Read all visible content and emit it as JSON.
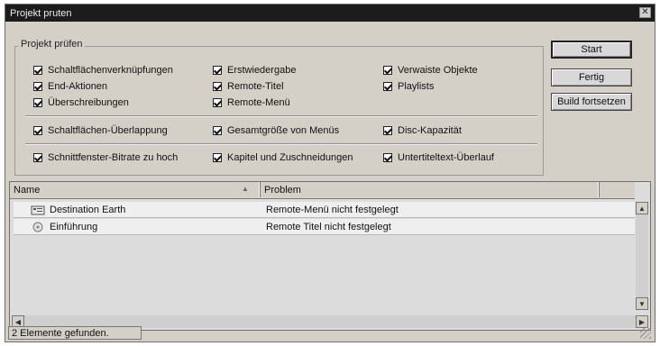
{
  "window": {
    "title": "Projekt pruten"
  },
  "group": {
    "title": "Projekt prüfen",
    "checkboxes": [
      {
        "label": "Schaltflächenverknüpfungen",
        "checked": true
      },
      {
        "label": "End-Aktionen",
        "checked": true
      },
      {
        "label": "Überschreibungen",
        "checked": true
      },
      {
        "label": "Erstwiedergabe",
        "checked": true
      },
      {
        "label": "Remote-Titel",
        "checked": true
      },
      {
        "label": "Remote-Menü",
        "checked": true
      },
      {
        "label": "Verwaiste Objekte",
        "checked": true
      },
      {
        "label": "Playlists",
        "checked": true
      },
      {
        "label": "Schaltflächen-Überlappung",
        "checked": true
      },
      {
        "label": "Gesamtgröße von Menüs",
        "checked": true
      },
      {
        "label": "Disc-Kapazität",
        "checked": true
      },
      {
        "label": "Schnittfenster-Bitrate zu hoch",
        "checked": true
      },
      {
        "label": "Kapitel und Zuschneidungen",
        "checked": true
      },
      {
        "label": "Untertiteltext-Überlauf",
        "checked": true
      }
    ]
  },
  "buttons": {
    "start": "Start",
    "fertig": "Fertig",
    "build": "Build fortsetzen"
  },
  "list": {
    "columns": [
      "Name",
      "Problem"
    ],
    "rows": [
      {
        "name": "Destination Earth",
        "problem": "Remote-Menü nicht festgelegt",
        "icon": "menu-icon"
      },
      {
        "name": "Einführung",
        "problem": "Remote Titel nicht festgelegt",
        "icon": "disc-icon"
      }
    ]
  },
  "status": {
    "text": "2 Elemente gefunden."
  },
  "icons": {
    "close": "close-icon",
    "sort": "sort-ascending-icon"
  }
}
